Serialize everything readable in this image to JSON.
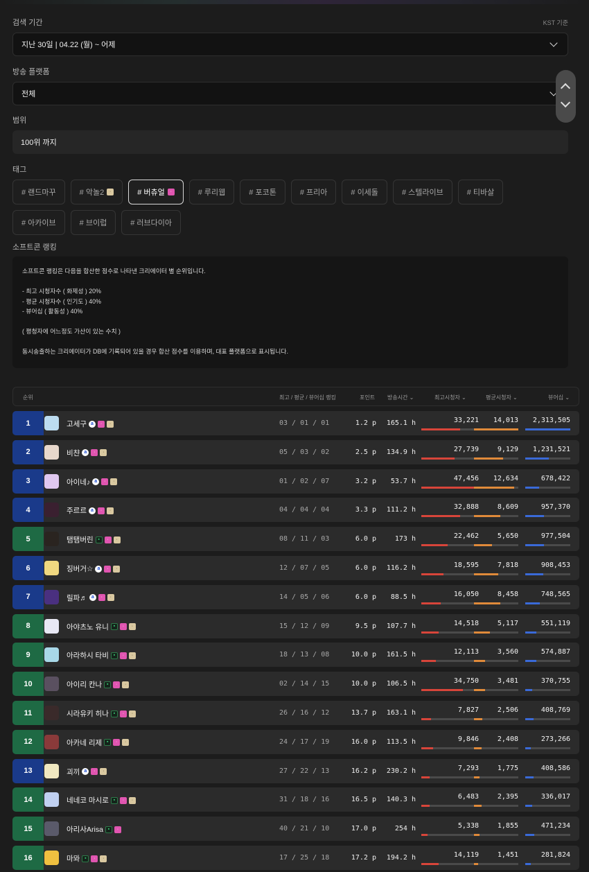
{
  "search_period": {
    "label": "검색 기간",
    "note": "KST 기준",
    "value": "지난 30일 | 04.22 (월) ~ 어제"
  },
  "platform": {
    "label": "방송 플랫폼",
    "value": "전체"
  },
  "range": {
    "label": "범위",
    "value": "100위 까지"
  },
  "tags": {
    "label": "태그",
    "items": [
      {
        "text": "# 랜드마꾸",
        "chip": null,
        "active": false
      },
      {
        "text": "# 악놀2",
        "chip": "beige",
        "active": false
      },
      {
        "text": "# 버츄얼",
        "chip": "pink",
        "active": true
      },
      {
        "text": "# 루리웹",
        "chip": null,
        "active": false
      },
      {
        "text": "# 포코톤",
        "chip": null,
        "active": false
      },
      {
        "text": "# 프리아",
        "chip": null,
        "active": false
      },
      {
        "text": "# 이세돌",
        "chip": null,
        "active": false
      },
      {
        "text": "# 스텔라이브",
        "chip": null,
        "active": false
      },
      {
        "text": "# 티바살",
        "chip": null,
        "active": false
      },
      {
        "text": "# 아카이브",
        "chip": null,
        "active": false
      },
      {
        "text": "# 브이럽",
        "chip": null,
        "active": false
      },
      {
        "text": "# 러브다이아",
        "chip": null,
        "active": false
      }
    ]
  },
  "softcon": {
    "label": "소프트콘 랭킹",
    "lines": [
      "소프트콘 랭킹은 다음을 합산한 점수로 나타낸 크리에이터 별 순위입니다.",
      "",
      "- 최고 시청자수 ( 화제성 ) 20%",
      "- 평균 시청자수 ( 인기도 ) 40%",
      "- 뷰어십 ( 활동성 ) 40%",
      "",
      "( 평청자에 어느정도 가산이 있는 수치 )",
      "",
      "동시송출하는 크리에이터가 DB에 기록되어 있을 경우 합산 점수를 이용하며, 대표 플랫폼으로 표시됩니다."
    ]
  },
  "table": {
    "headers": {
      "rank": "순위",
      "ranks3": "최고 / 평균 / 뷰어십 랭킹",
      "point": "포인트",
      "hours": "방송시간",
      "peak": "최고시청자",
      "avg": "평균시청자",
      "viewership": "뷰어십"
    },
    "colors": {
      "blue_rank": "#1a3a8a",
      "green_rank": "#1e6a44",
      "peak_bar": "#d8453a",
      "avg_bar": "#e08a3a",
      "viewership_bar": "#3a6ad8"
    },
    "rows": [
      {
        "rank": "1",
        "platform": "blue",
        "name": "고세구",
        "chips": [
          "blue",
          "pink",
          "beige"
        ],
        "ranks3": "03 / 01 / 01",
        "point": "1.2 p",
        "hours": "165.1 h",
        "peak": "33,221",
        "avg": "14,013",
        "viewership": "2,313,505",
        "peak_frac": 0.68,
        "avg_frac": 1.0,
        "view_frac": 1.0,
        "avatar": "#bcdcf0"
      },
      {
        "rank": "2",
        "platform": "blue",
        "name": "비챤",
        "chips": [
          "blue",
          "pink",
          "beige"
        ],
        "ranks3": "05 / 03 / 02",
        "point": "2.5 p",
        "hours": "134.9 h",
        "peak": "27,739",
        "avg": "9,129",
        "viewership": "1,231,521",
        "peak_frac": 0.58,
        "avg_frac": 0.65,
        "view_frac": 0.53,
        "avatar": "#e8d8cc"
      },
      {
        "rank": "3",
        "platform": "blue",
        "name": "아이네♪",
        "chips": [
          "blue",
          "pink",
          "beige"
        ],
        "ranks3": "01 / 02 / 07",
        "point": "3.2 p",
        "hours": "53.7 h",
        "peak": "47,456",
        "avg": "12,634",
        "viewership": "678,422",
        "peak_frac": 1.0,
        "avg_frac": 0.9,
        "view_frac": 0.3,
        "avatar": "#e0c8f0"
      },
      {
        "rank": "4",
        "platform": "blue",
        "name": "주르르",
        "chips": [
          "blue",
          "pink",
          "beige"
        ],
        "ranks3": "04 / 04 / 04",
        "point": "3.3 p",
        "hours": "111.2 h",
        "peak": "32,888",
        "avg": "8,609",
        "viewership": "957,370",
        "peak_frac": 0.68,
        "avg_frac": 0.6,
        "view_frac": 0.42,
        "avatar": "#3a2030"
      },
      {
        "rank": "5",
        "platform": "green",
        "name": "탬탬버린",
        "chips": [
          "green",
          "pink",
          "beige"
        ],
        "ranks3": "08 / 11 / 03",
        "point": "6.0 p",
        "hours": "173 h",
        "peak": "22,462",
        "avg": "5,650",
        "viewership": "977,504",
        "peak_frac": 0.46,
        "avg_frac": 0.4,
        "view_frac": 0.42,
        "avatar": "#2a2420"
      },
      {
        "rank": "6",
        "platform": "blue",
        "name": "징버거☆",
        "chips": [
          "blue",
          "pink",
          "beige"
        ],
        "ranks3": "12 / 07 / 05",
        "point": "6.0 p",
        "hours": "116.2 h",
        "peak": "18,595",
        "avg": "7,818",
        "viewership": "908,453",
        "peak_frac": 0.38,
        "avg_frac": 0.55,
        "view_frac": 0.4,
        "avatar": "#f0d880"
      },
      {
        "rank": "7",
        "platform": "blue",
        "name": "릴파♬",
        "chips": [
          "blue",
          "pink",
          "beige"
        ],
        "ranks3": "14 / 05 / 06",
        "point": "6.0 p",
        "hours": "88.5 h",
        "peak": "16,050",
        "avg": "8,458",
        "viewership": "748,565",
        "peak_frac": 0.34,
        "avg_frac": 0.6,
        "view_frac": 0.32,
        "avatar": "#4a3080"
      },
      {
        "rank": "8",
        "platform": "green",
        "name": "아야츠노 유니",
        "chips": [
          "green",
          "pink",
          "beige"
        ],
        "ranks3": "15 / 12 / 09",
        "point": "9.5 p",
        "hours": "107.7 h",
        "peak": "14,518",
        "avg": "5,117",
        "viewership": "551,119",
        "peak_frac": 0.3,
        "avg_frac": 0.36,
        "view_frac": 0.24,
        "avatar": "#e8e8f4"
      },
      {
        "rank": "9",
        "platform": "green",
        "name": "아라하시 타비",
        "chips": [
          "green",
          "pink",
          "beige"
        ],
        "ranks3": "18 / 13 / 08",
        "point": "10.0 p",
        "hours": "161.5 h",
        "peak": "12,113",
        "avg": "3,560",
        "viewership": "574,887",
        "peak_frac": 0.25,
        "avg_frac": 0.25,
        "view_frac": 0.25,
        "avatar": "#a8d8e8"
      },
      {
        "rank": "10",
        "platform": "green",
        "name": "아이리 칸나",
        "chips": [
          "green",
          "pink",
          "beige"
        ],
        "ranks3": "02 / 14 / 15",
        "point": "10.0 p",
        "hours": "106.5 h",
        "peak": "34,750",
        "avg": "3,481",
        "viewership": "370,755",
        "peak_frac": 0.72,
        "avg_frac": 0.25,
        "view_frac": 0.16,
        "avatar": "#5a5060"
      },
      {
        "rank": "11",
        "platform": "green",
        "name": "시라유키 히나",
        "chips": [
          "green",
          "pink",
          "beige"
        ],
        "ranks3": "26 / 16 / 12",
        "point": "13.7 p",
        "hours": "163.1 h",
        "peak": "7,827",
        "avg": "2,506",
        "viewership": "408,769",
        "peak_frac": 0.17,
        "avg_frac": 0.18,
        "view_frac": 0.18,
        "avatar": "#3a2a2a"
      },
      {
        "rank": "12",
        "platform": "green",
        "name": "아카네 리제",
        "chips": [
          "green",
          "pink",
          "beige"
        ],
        "ranks3": "24 / 17 / 19",
        "point": "16.0 p",
        "hours": "113.5 h",
        "peak": "9,846",
        "avg": "2,408",
        "viewership": "273,266",
        "peak_frac": 0.2,
        "avg_frac": 0.17,
        "view_frac": 0.12,
        "avatar": "#8a3a3a"
      },
      {
        "rank": "13",
        "platform": "blue",
        "name": "괴끼",
        "chips": [
          "blue",
          "pink",
          "beige"
        ],
        "ranks3": "27 / 22 / 13",
        "point": "16.2 p",
        "hours": "230.2 h",
        "peak": "7,293",
        "avg": "1,775",
        "viewership": "408,586",
        "peak_frac": 0.15,
        "avg_frac": 0.13,
        "view_frac": 0.18,
        "avatar": "#f0e8c0"
      },
      {
        "rank": "14",
        "platform": "green",
        "name": "네네코 마시로",
        "chips": [
          "green",
          "pink",
          "beige"
        ],
        "ranks3": "31 / 18 / 16",
        "point": "16.5 p",
        "hours": "140.3 h",
        "peak": "6,483",
        "avg": "2,395",
        "viewership": "336,017",
        "peak_frac": 0.14,
        "avg_frac": 0.17,
        "view_frac": 0.15,
        "avatar": "#c0d0f0"
      },
      {
        "rank": "15",
        "platform": "green",
        "name": "아리사Arisa",
        "chips": [
          "green",
          "pink"
        ],
        "ranks3": "40 / 21 / 10",
        "point": "17.0 p",
        "hours": "254 h",
        "peak": "5,338",
        "avg": "1,855",
        "viewership": "471,234",
        "peak_frac": 0.11,
        "avg_frac": 0.13,
        "view_frac": 0.2,
        "avatar": "#5a5a6a"
      },
      {
        "rank": "16",
        "platform": "green",
        "name": "마뫄",
        "chips": [
          "green",
          "pink",
          "beige"
        ],
        "ranks3": "17 / 25 / 18",
        "point": "17.2 p",
        "hours": "194.2 h",
        "peak": "14,119",
        "avg": "1,451",
        "viewership": "281,824",
        "peak_frac": 0.3,
        "avg_frac": 0.1,
        "view_frac": 0.12,
        "avatar": "#f0c040"
      }
    ]
  }
}
